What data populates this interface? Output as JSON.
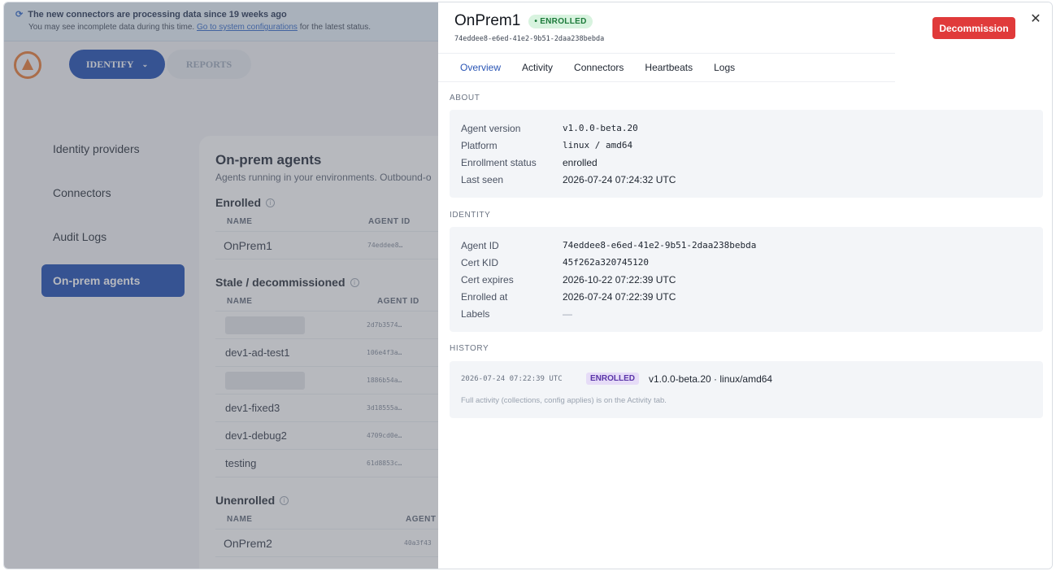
{
  "banner": {
    "title": "The new connectors are processing data since 19 weeks ago",
    "message": "You may see incomplete data during this time.",
    "link": "Go to system configurations",
    "suffix": "for the latest status."
  },
  "topnav": {
    "identify": "IDENTIFY",
    "reports": "REPORTS"
  },
  "sidebar": {
    "items": [
      {
        "label": "Identity providers"
      },
      {
        "label": "Connectors"
      },
      {
        "label": "Audit Logs"
      },
      {
        "label": "On-prem agents"
      }
    ]
  },
  "agents_page": {
    "title": "On-prem agents",
    "subtitle": "Agents running in your environments. Outbound-o",
    "enrolled": {
      "heading": "Enrolled",
      "col_name": "NAME",
      "col_id": "AGENT ID",
      "rows": [
        {
          "name": "OnPrem1",
          "id": "74eddee8…"
        }
      ]
    },
    "stale": {
      "heading": "Stale / decommissioned",
      "col_name": "NAME",
      "col_id": "AGENT ID",
      "rows": [
        {
          "name": "",
          "id": "2d7b3574…"
        },
        {
          "name": "dev1-ad-test1",
          "id": "106e4f3a…"
        },
        {
          "name": "",
          "id": "1886b54a…"
        },
        {
          "name": "dev1-fixed3",
          "id": "3d18555a…"
        },
        {
          "name": "dev1-debug2",
          "id": "4709cd0e…"
        },
        {
          "name": "testing",
          "id": "61d8853c…"
        }
      ]
    },
    "unenrolled": {
      "heading": "Unenrolled",
      "col_name": "NAME",
      "col_id": "AGENT",
      "rows": [
        {
          "name": "OnPrem2",
          "id": "40a3f43"
        }
      ]
    }
  },
  "drawer": {
    "name": "OnPrem1",
    "status_badge": "• ENROLLED",
    "agent_id": "74eddee8-e6ed-41e2-9b51-2daa238bebda",
    "decommission_label": "Decommission",
    "close_label": "✕",
    "tabs": [
      "Overview",
      "Activity",
      "Connectors",
      "Heartbeats",
      "Logs"
    ],
    "about": {
      "label": "ABOUT",
      "rows": [
        {
          "k": "Agent version",
          "v": "v1.0.0-beta.20"
        },
        {
          "k": "Platform",
          "v": "linux / amd64"
        },
        {
          "k": "Enrollment status",
          "v": "enrolled"
        },
        {
          "k": "Last seen",
          "v": "2026-07-24 07:24:32 UTC"
        }
      ]
    },
    "identity": {
      "label": "IDENTITY",
      "rows": [
        {
          "k": "Agent ID",
          "v": "74eddee8-e6ed-41e2-9b51-2daa238bebda"
        },
        {
          "k": "Cert KID",
          "v": "45f262a320745120"
        },
        {
          "k": "Cert expires",
          "v": "2026-10-22 07:22:39 UTC"
        },
        {
          "k": "Enrolled at",
          "v": "2026-07-24 07:22:39 UTC"
        },
        {
          "k": "Labels",
          "v": "—"
        }
      ]
    },
    "history": {
      "label": "HISTORY",
      "timestamp": "2026-07-24 07:22:39 UTC",
      "event": "ENROLLED",
      "detail": "v1.0.0-beta.20 · linux/amd64",
      "note": "Full activity (collections, config applies) is on the Activity tab."
    }
  }
}
